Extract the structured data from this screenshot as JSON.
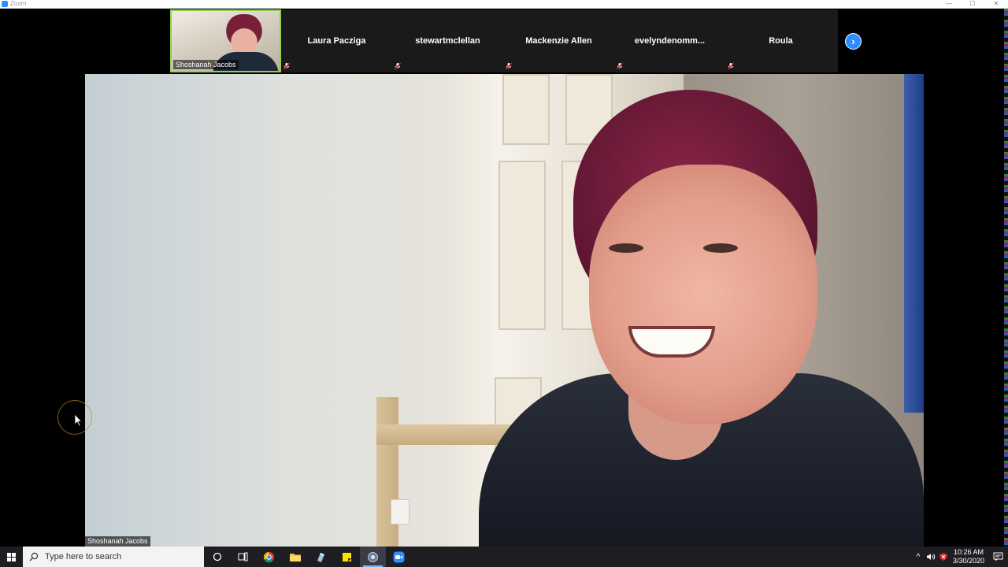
{
  "window": {
    "title": "Zoom",
    "controls": {
      "minimize": "—",
      "maximize": "☐",
      "close": "✕"
    }
  },
  "thumbnails": [
    {
      "name": "Shoshanah Jacobs",
      "type": "video",
      "active": true
    },
    {
      "name": "Laura Pacziga",
      "type": "name",
      "muted": true
    },
    {
      "name": "stewartmclellan",
      "type": "name",
      "muted": true
    },
    {
      "name": "Mackenzie Allen",
      "type": "name",
      "muted": true
    },
    {
      "name": "evelyndenomm...",
      "type": "name",
      "muted": true
    },
    {
      "name": "Roula",
      "type": "name",
      "muted": true
    }
  ],
  "strip_next_icon": "›",
  "main_speaker": {
    "name": "Shoshanah Jacobs"
  },
  "taskbar": {
    "search_placeholder": "Type here to search",
    "pinned": [
      {
        "name": "cortana-icon"
      },
      {
        "name": "task-view-icon"
      },
      {
        "name": "chrome-icon"
      },
      {
        "name": "file-explorer-icon"
      },
      {
        "name": "app-icon"
      },
      {
        "name": "sticky-notes-icon"
      },
      {
        "name": "recorder-icon",
        "active": true
      },
      {
        "name": "zoom-icon"
      }
    ],
    "tray": {
      "chevron": "^",
      "time": "10:26 AM",
      "date": "3/30/2020"
    }
  },
  "colors": {
    "accent": "#2d8cff",
    "active_border": "#8fd14f",
    "muted_red": "#e02828",
    "taskbar": "#1e1e22"
  }
}
